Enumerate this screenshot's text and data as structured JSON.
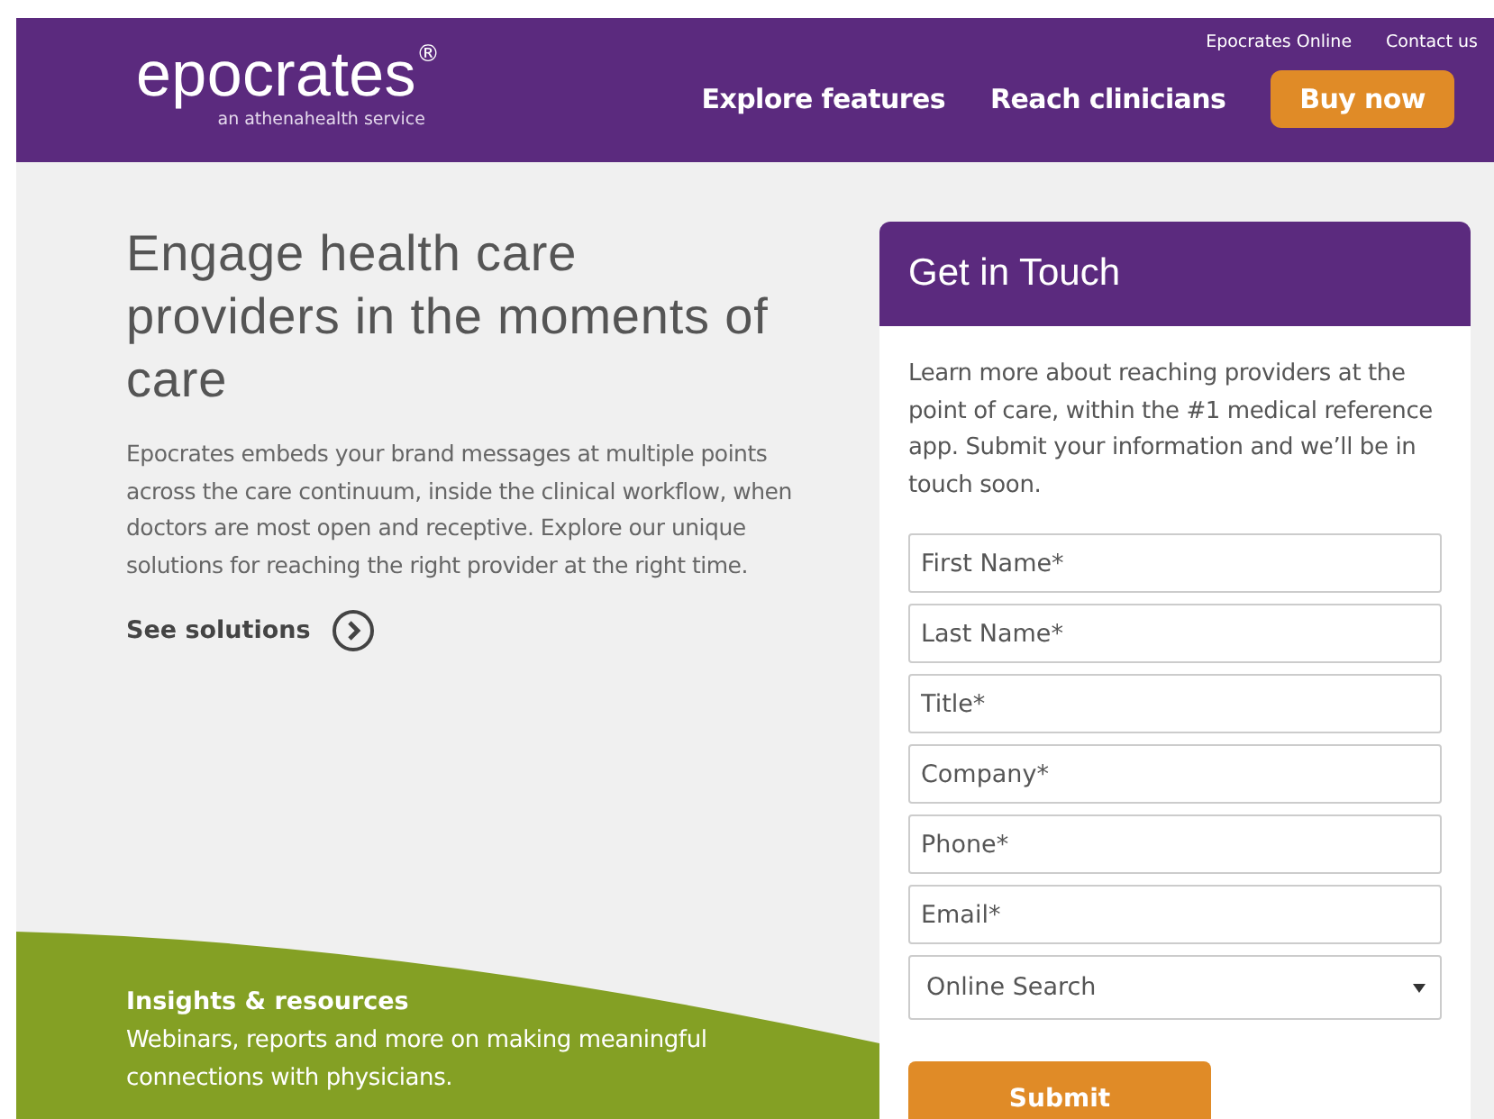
{
  "header": {
    "logo": "epocrates",
    "logo_mark": "®",
    "tagline": "an athenahealth service",
    "utility_links": [
      "Epocrates Online",
      "Contact us"
    ],
    "nav": [
      {
        "label": "Explore features",
        "kind": "link"
      },
      {
        "label": "Reach clinicians",
        "kind": "link"
      },
      {
        "label": "Buy now",
        "kind": "button"
      }
    ]
  },
  "hero": {
    "headline": "Engage health care providers in the moments of care",
    "body": "Epocrates embeds your brand messages at multiple points across the care continuum, inside the clinical workflow, when doctors are most open and receptive. Explore our unique solutions for reaching the right provider at the right time.",
    "link": "See solutions"
  },
  "promo": {
    "title": "Insights & resources",
    "text": "Webinars, reports and more on making meaningful connections with physicians."
  },
  "form": {
    "title": "Get in Touch",
    "intro": "Learn more about reaching providers at the point of care, within the #1 medical reference app. Submit your information and we’ll be in touch soon.",
    "fields": [
      {
        "kind": "text",
        "placeholder": "First Name*"
      },
      {
        "kind": "text",
        "placeholder": "Last Name*"
      },
      {
        "kind": "text",
        "placeholder": "Title*"
      },
      {
        "kind": "text",
        "placeholder": "Company*"
      },
      {
        "kind": "text",
        "placeholder": "Phone*"
      },
      {
        "kind": "text",
        "placeholder": "Email*"
      },
      {
        "kind": "select",
        "value": "Online Search"
      }
    ],
    "submit": "Submit"
  }
}
